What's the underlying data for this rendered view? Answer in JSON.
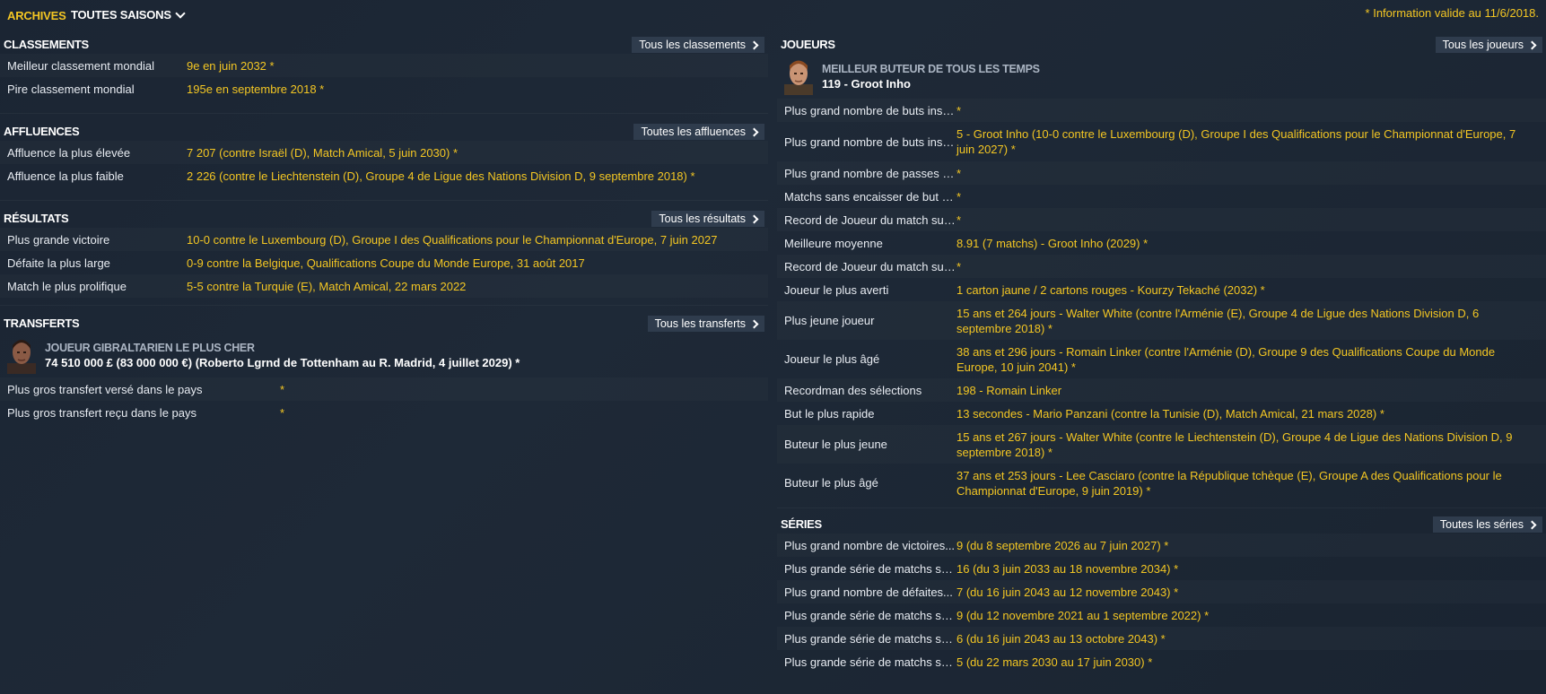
{
  "topbar": {
    "archives_label": "ARCHIVES",
    "season_label": "TOUTES SAISONS",
    "info_note": "* Information valide au 11/6/2018."
  },
  "classements": {
    "title": "CLASSEMENTS",
    "more": "Tous les classements",
    "rows": [
      {
        "label": "Meilleur classement mondial",
        "value": "9e en juin 2032 *"
      },
      {
        "label": "Pire classement mondial",
        "value": "195e en septembre 2018 *"
      }
    ]
  },
  "affluences": {
    "title": "AFFLUENCES",
    "more": "Toutes les affluences",
    "rows": [
      {
        "label": "Affluence la plus élevée",
        "value": "7 207 (contre Israël (D), Match Amical, 5 juin 2030) *"
      },
      {
        "label": "Affluence la plus faible",
        "value": "2 226 (contre le Liechtenstein (D), Groupe 4 de Ligue des Nations Division D, 9 septembre 2018) *"
      }
    ]
  },
  "resultats": {
    "title": "RÉSULTATS",
    "more": "Tous les résultats",
    "rows": [
      {
        "label": "Plus grande victoire",
        "value": "10-0 contre le Luxembourg (D), Groupe I des Qualifications pour le Championnat d'Europe, 7 juin 2027"
      },
      {
        "label": "Défaite la plus large",
        "value": "0-9 contre la Belgique, Qualifications Coupe du Monde Europe, 31 août 2017"
      },
      {
        "label": "Match le plus prolifique",
        "value": "5-5 contre la Turquie (E), Match Amical, 22 mars 2022"
      }
    ]
  },
  "transferts": {
    "title": "TRANSFERTS",
    "more": "Tous les transferts",
    "featured_caption": "JOUEUR GIBRALTARIEN LE PLUS CHER",
    "featured_value": "74 510 000 £ (83 000 000 €) (Roberto Lgrnd de Tottenham au R. Madrid, 4 juillet 2029) *",
    "rows": [
      {
        "label": "Plus gros transfert versé dans le pays",
        "value": "*"
      },
      {
        "label": "Plus gros transfert reçu dans le pays",
        "value": "*"
      }
    ]
  },
  "joueurs": {
    "title": "JOUEURS",
    "more": "Tous les joueurs",
    "featured_caption": "MEILLEUR BUTEUR DE TOUS LES TEMPS",
    "featured_value": "119 - Groot Inho",
    "rows": [
      {
        "label": "Plus grand nombre de buts insc...",
        "value": "*"
      },
      {
        "label": "Plus grand nombre de buts insc...",
        "value": "5 - Groot Inho (10-0 contre le Luxembourg (D), Groupe I des Qualifications pour le Championnat d'Europe, 7 juin 2027) *"
      },
      {
        "label": "Plus grand nombre de passes d...",
        "value": "*"
      },
      {
        "label": "Matchs sans encaisser de but (j...",
        "value": "*"
      },
      {
        "label": "Record de Joueur du match sur...",
        "value": "*"
      },
      {
        "label": "Meilleure moyenne",
        "value": "8.91 (7 matchs) - Groot Inho (2029) *"
      },
      {
        "label": "Record de Joueur du match sur...",
        "value": "*"
      },
      {
        "label": "Joueur le plus averti",
        "value": "1 carton jaune / 2 cartons rouges - Kourzy Tekaché (2032) *"
      },
      {
        "label": "Plus jeune joueur",
        "value": "15 ans et 264 jours - Walter White (contre l'Arménie (E), Groupe 4 de Ligue des Nations Division D, 6 septembre 2018) *"
      },
      {
        "label": "Joueur le plus âgé",
        "value": "38 ans et 296 jours - Romain Linker (contre l'Arménie (D), Groupe 9 des Qualifications Coupe du Monde Europe, 10 juin 2041) *"
      },
      {
        "label": "Recordman des sélections",
        "value": "198 - Romain Linker"
      },
      {
        "label": "But le plus rapide",
        "value": "13 secondes - Mario Panzani (contre la Tunisie (D), Match Amical, 21 mars 2028) *"
      },
      {
        "label": "Buteur le plus jeune",
        "value": "15 ans et 267 jours - Walter White (contre le Liechtenstein (D), Groupe 4 de Ligue des Nations Division D, 9 septembre 2018) *"
      },
      {
        "label": "Buteur le plus âgé",
        "value": "37 ans et 253 jours - Lee Casciaro (contre la République tchèque (E), Groupe A des Qualifications pour le Championnat d'Europe, 9 juin 2019) *"
      }
    ]
  },
  "series": {
    "title": "SÉRIES",
    "more": "Toutes les séries",
    "rows": [
      {
        "label": "Plus grand nombre de victoires...",
        "value": "9 (du 8 septembre 2026 au 7 juin 2027) *"
      },
      {
        "label": "Plus grande série de matchs sa...",
        "value": "16 (du 3 juin 2033 au 18 novembre 2034) *"
      },
      {
        "label": "Plus grand nombre de défaites...",
        "value": "7 (du 16 juin 2043 au 12 novembre 2043) *"
      },
      {
        "label": "Plus grande série de matchs sa...",
        "value": "9 (du 12 novembre 2021 au 1 septembre 2022) *"
      },
      {
        "label": "Plus grande série de matchs sa...",
        "value": "6 (du 16 juin 2043 au 13 octobre 2043) *"
      },
      {
        "label": "Plus grande série de matchs sa...",
        "value": "5 (du 22 mars 2030 au 17 juin 2030) *"
      }
    ]
  }
}
